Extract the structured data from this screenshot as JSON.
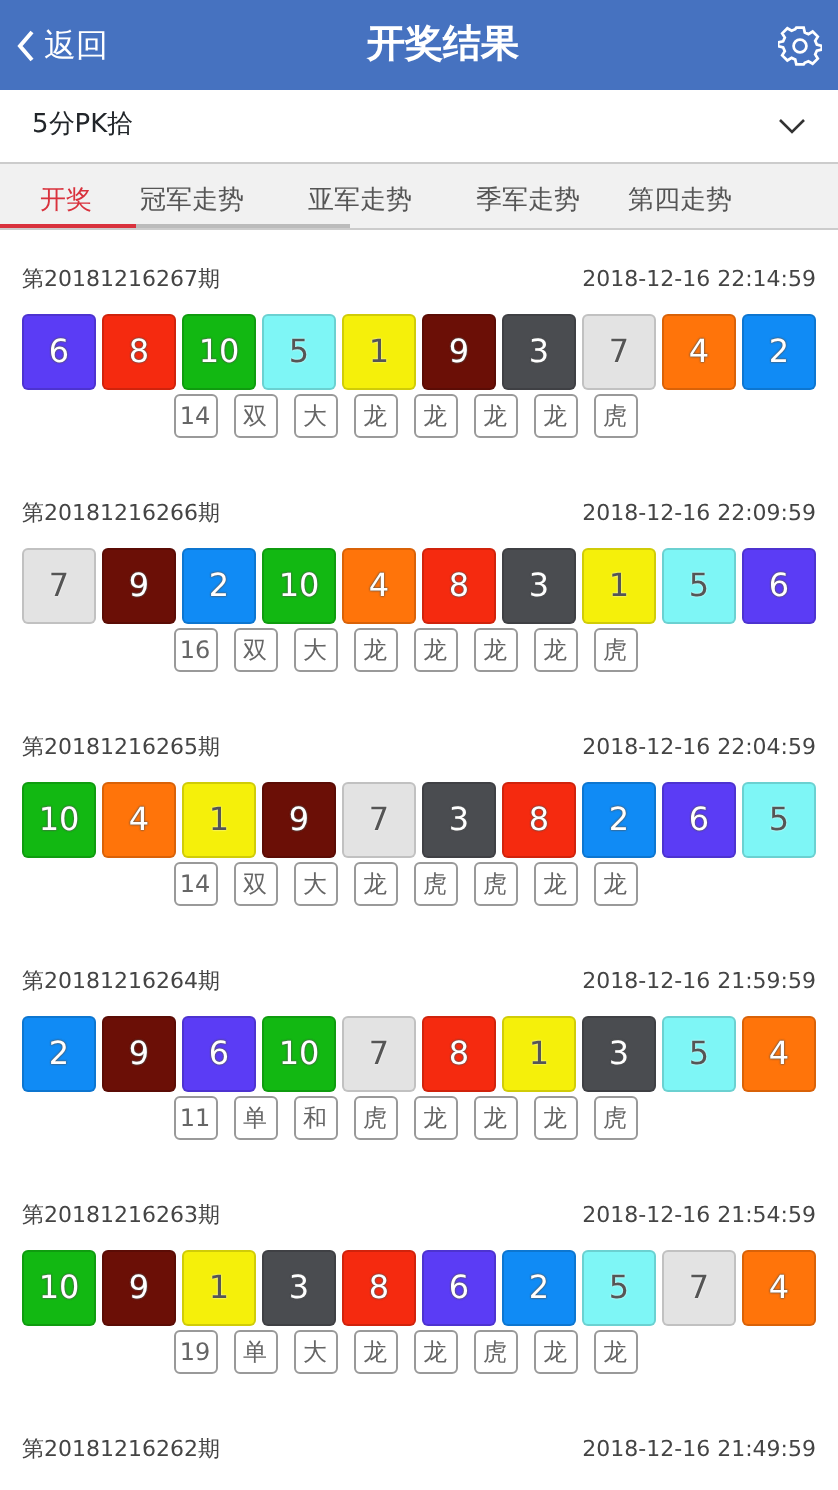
{
  "header": {
    "back": "返回",
    "title": "开奖结果"
  },
  "game_select": {
    "value": "5分PK拾"
  },
  "tabs": [
    {
      "label": "开奖",
      "selected": true
    },
    {
      "label": "冠军走势",
      "selected": false
    },
    {
      "label": "亚军走势",
      "selected": false
    },
    {
      "label": "季军走势",
      "selected": false
    },
    {
      "label": "第四走势",
      "selected": false
    }
  ],
  "draws": [
    {
      "period": "第20181216267期",
      "time": "2018-12-16 22:14:59",
      "balls": [
        {
          "number": "6",
          "color": "#5b3cf5"
        },
        {
          "number": "8",
          "color": "#f52a0f"
        },
        {
          "number": "10",
          "color": "#12b812"
        },
        {
          "number": "5",
          "color": "#7ef6f6"
        },
        {
          "number": "1",
          "color": "#f5f00a"
        },
        {
          "number": "9",
          "color": "#6b0f06"
        },
        {
          "number": "3",
          "color": "#4a4c50"
        },
        {
          "number": "7",
          "color": "#e3e3e3"
        },
        {
          "number": "4",
          "color": "#ff740a"
        },
        {
          "number": "2",
          "color": "#108bf5"
        }
      ],
      "tags": [
        "14",
        "双",
        "大",
        "龙",
        "龙",
        "龙",
        "龙",
        "虎"
      ]
    },
    {
      "period": "第20181216266期",
      "time": "2018-12-16 22:09:59",
      "balls": [
        {
          "number": "7",
          "color": "#e3e3e3"
        },
        {
          "number": "9",
          "color": "#6b0f06"
        },
        {
          "number": "2",
          "color": "#108bf5"
        },
        {
          "number": "10",
          "color": "#12b812"
        },
        {
          "number": "4",
          "color": "#ff740a"
        },
        {
          "number": "8",
          "color": "#f52a0f"
        },
        {
          "number": "3",
          "color": "#4a4c50"
        },
        {
          "number": "1",
          "color": "#f5f00a"
        },
        {
          "number": "5",
          "color": "#7ef6f6"
        },
        {
          "number": "6",
          "color": "#5b3cf5"
        }
      ],
      "tags": [
        "16",
        "双",
        "大",
        "龙",
        "龙",
        "龙",
        "龙",
        "虎"
      ]
    },
    {
      "period": "第20181216265期",
      "time": "2018-12-16 22:04:59",
      "balls": [
        {
          "number": "10",
          "color": "#12b812"
        },
        {
          "number": "4",
          "color": "#ff740a"
        },
        {
          "number": "1",
          "color": "#f5f00a"
        },
        {
          "number": "9",
          "color": "#6b0f06"
        },
        {
          "number": "7",
          "color": "#e3e3e3"
        },
        {
          "number": "3",
          "color": "#4a4c50"
        },
        {
          "number": "8",
          "color": "#f52a0f"
        },
        {
          "number": "2",
          "color": "#108bf5"
        },
        {
          "number": "6",
          "color": "#5b3cf5"
        },
        {
          "number": "5",
          "color": "#7ef6f6"
        }
      ],
      "tags": [
        "14",
        "双",
        "大",
        "龙",
        "虎",
        "虎",
        "龙",
        "龙"
      ]
    },
    {
      "period": "第20181216264期",
      "time": "2018-12-16 21:59:59",
      "balls": [
        {
          "number": "2",
          "color": "#108bf5"
        },
        {
          "number": "9",
          "color": "#6b0f06"
        },
        {
          "number": "6",
          "color": "#5b3cf5"
        },
        {
          "number": "10",
          "color": "#12b812"
        },
        {
          "number": "7",
          "color": "#e3e3e3"
        },
        {
          "number": "8",
          "color": "#f52a0f"
        },
        {
          "number": "1",
          "color": "#f5f00a"
        },
        {
          "number": "3",
          "color": "#4a4c50"
        },
        {
          "number": "5",
          "color": "#7ef6f6"
        },
        {
          "number": "4",
          "color": "#ff740a"
        }
      ],
      "tags": [
        "11",
        "单",
        "和",
        "虎",
        "龙",
        "龙",
        "龙",
        "虎"
      ]
    },
    {
      "period": "第20181216263期",
      "time": "2018-12-16 21:54:59",
      "balls": [
        {
          "number": "10",
          "color": "#12b812"
        },
        {
          "number": "9",
          "color": "#6b0f06"
        },
        {
          "number": "1",
          "color": "#f5f00a"
        },
        {
          "number": "3",
          "color": "#4a4c50"
        },
        {
          "number": "8",
          "color": "#f52a0f"
        },
        {
          "number": "6",
          "color": "#5b3cf5"
        },
        {
          "number": "2",
          "color": "#108bf5"
        },
        {
          "number": "5",
          "color": "#7ef6f6"
        },
        {
          "number": "7",
          "color": "#e3e3e3"
        },
        {
          "number": "4",
          "color": "#ff740a"
        }
      ],
      "tags": [
        "19",
        "单",
        "大",
        "龙",
        "龙",
        "虎",
        "龙",
        "龙"
      ]
    },
    {
      "period": "第20181216262期",
      "time": "2018-12-16 21:49:59"
    }
  ]
}
